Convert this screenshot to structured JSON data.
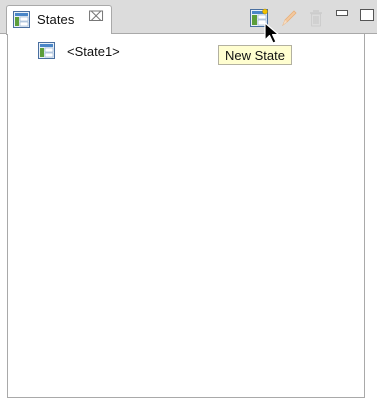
{
  "view": {
    "tab_label": "States",
    "tab_close_glyph": "⌧",
    "icons": {
      "tab_icon": "state-icon",
      "new_state": "new-state-icon",
      "edit": "pencil-icon",
      "delete": "trash-icon",
      "minimize": "minimize-icon",
      "maximize": "maximize-icon"
    }
  },
  "tree": {
    "items": [
      {
        "label": "<State1>",
        "icon": "state-icon"
      }
    ]
  },
  "tooltip": {
    "text": "New State"
  },
  "colors": {
    "tooltip_bg": "#fffed0",
    "icon_green": "#5c9e3a",
    "icon_blue": "#4a86c8"
  }
}
